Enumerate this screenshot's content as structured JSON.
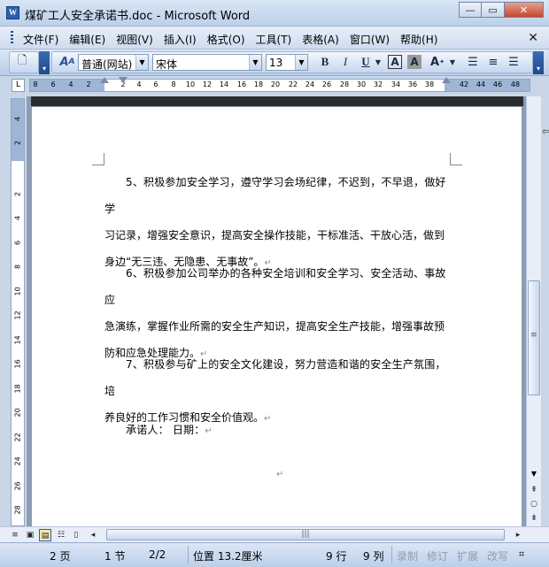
{
  "window": {
    "title": "煤矿工人安全承诺书.doc - Microsoft Word",
    "app_icon": "W",
    "controls": [
      "minimize",
      "maximize",
      "close"
    ]
  },
  "menu": [
    "文件(F)",
    "编辑(E)",
    "视图(V)",
    "插入(I)",
    "格式(O)",
    "工具(T)",
    "表格(A)",
    "窗口(W)",
    "帮助(H)"
  ],
  "toolbar": {
    "style": "普通(网站)",
    "font": "宋体",
    "size": "13",
    "bold": "B",
    "italic": "I",
    "underline": "U",
    "char_border": "A",
    "char_shading": "A",
    "insert_symbol": "A"
  },
  "ruler": {
    "corner": "L",
    "h_ticks": [
      "8",
      "6",
      "4",
      "2",
      "2",
      "4",
      "6",
      "8",
      "10",
      "12",
      "14",
      "16",
      "18",
      "20",
      "22",
      "24",
      "26",
      "28",
      "30",
      "32",
      "34",
      "36",
      "38",
      "42",
      "44",
      "46",
      "48"
    ],
    "v_ticks": [
      "4",
      "2",
      "2",
      "4",
      "6",
      "8",
      "10",
      "12",
      "14",
      "16",
      "18",
      "20",
      "22",
      "24",
      "26",
      "28"
    ]
  },
  "document": {
    "paragraphs": [
      {
        "lines": [
          "5、积极参加安全学习，遵守学习会场纪律，不迟到，不早退，做好学",
          "习记录，增强安全意识，提高安全操作技能，干标准活、干放心活，做到",
          "身边“无三违、无隐患、无事故”。"
        ]
      },
      {
        "lines": [
          "6、积极参加公司举办的各种安全培训和安全学习、安全活动、事故应",
          "急演练，掌握作业所需的安全生产知识，提高安全生产技能，增强事故预",
          "防和应急处理能力。"
        ]
      },
      {
        "lines": [
          "7、积极参与矿上的安全文化建设，努力营造和谐的安全生产氛围，培",
          "养良好的工作习惯和安全价值观。"
        ]
      },
      {
        "lines": [
          "承诺人：  日期："
        ]
      }
    ],
    "para_mark": "↵"
  },
  "status": {
    "page": "2 页",
    "section": "1 节",
    "pages": "2/2",
    "position": "位置 13.2厘米",
    "line": "9 行",
    "column": "9 列",
    "modes": [
      "录制",
      "修订",
      "扩展",
      "改写"
    ]
  }
}
